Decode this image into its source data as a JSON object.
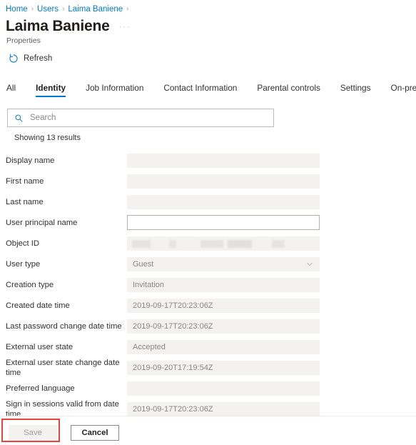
{
  "breadcrumb": {
    "items": [
      {
        "label": "Home"
      },
      {
        "label": "Users"
      },
      {
        "label": "Laima Baniene"
      }
    ],
    "separator": "›"
  },
  "header": {
    "title": "Laima Baniene",
    "subtitle": "Properties",
    "more_menu": "···"
  },
  "commandbar": {
    "refresh_label": "Refresh",
    "refresh_icon": "refresh-icon"
  },
  "tabs": [
    {
      "label": "All",
      "active": false
    },
    {
      "label": "Identity",
      "active": true
    },
    {
      "label": "Job Information",
      "active": false
    },
    {
      "label": "Contact Information",
      "active": false
    },
    {
      "label": "Parental controls",
      "active": false
    },
    {
      "label": "Settings",
      "active": false
    },
    {
      "label": "On-premises",
      "active": false
    }
  ],
  "search": {
    "placeholder": "Search",
    "value": "",
    "icon": "search-icon"
  },
  "results": {
    "count_text": "Showing 13 results"
  },
  "fields": [
    {
      "label": "Display name",
      "value": "",
      "state": "readonly"
    },
    {
      "label": "First name",
      "value": "",
      "state": "readonly"
    },
    {
      "label": "Last name",
      "value": "",
      "state": "readonly"
    },
    {
      "label": "User principal name",
      "value": "",
      "state": "editable"
    },
    {
      "label": "Object ID",
      "value": "",
      "state": "redacted"
    },
    {
      "label": "User type",
      "value": "Guest",
      "state": "dropdown"
    },
    {
      "label": "Creation type",
      "value": "Invitation",
      "state": "readonly"
    },
    {
      "label": "Created date time",
      "value": "2019-09-17T20:23:06Z",
      "state": "readonly"
    },
    {
      "label": "Last password change date time",
      "value": "2019-09-17T20:23:06Z",
      "state": "readonly"
    },
    {
      "label": "External user state",
      "value": "Accepted",
      "state": "readonly"
    },
    {
      "label": "External user state change date time",
      "value": "2019-09-20T17:19:54Z",
      "state": "readonly"
    },
    {
      "label": "Preferred language",
      "value": "",
      "state": "readonly"
    },
    {
      "label": "Sign in sessions valid from date time",
      "value": "2019-09-17T20:23:06Z",
      "state": "readonly"
    }
  ],
  "footer": {
    "save_label": "Save",
    "cancel_label": "Cancel",
    "save_disabled": true
  },
  "colors": {
    "accent": "#0078d4",
    "link": "#0078d4",
    "highlight": "#e8443a",
    "field_bg": "#f3f2f1",
    "text": "#323130",
    "muted_text": "#8a8886"
  }
}
